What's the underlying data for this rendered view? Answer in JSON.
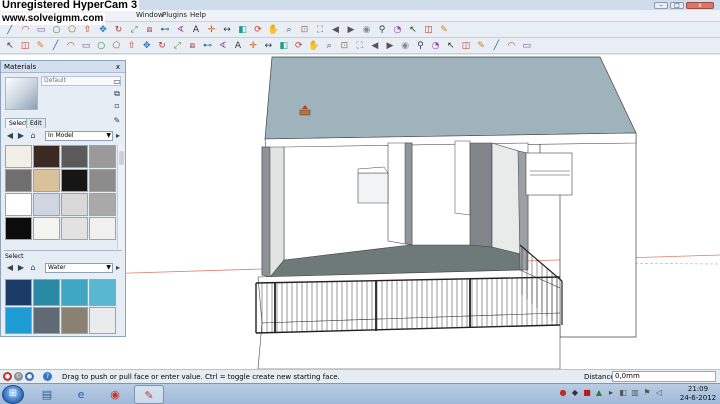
{
  "watermark": {
    "line1": "Unregistered HyperCam 3",
    "line2": "www.solveigmm.com"
  },
  "menu": {
    "items": [
      "Window",
      "Plugins",
      "Help"
    ]
  },
  "materials": {
    "title": "Materials",
    "close": "x",
    "name_placeholder": "Default",
    "tabs": {
      "select": "Select",
      "edit": "Edit"
    },
    "collection1": "In Model",
    "section2_label": "Select",
    "collection2": "Water",
    "swatches_top": [
      "#f2efe6",
      "#3a2a22",
      "#5a5a5a",
      "#9a9a9a",
      "#6f6f6f",
      "#d9c19a",
      "#161616",
      "#8c8c8c",
      "#ffffff",
      "#cfd6e2",
      "#d8d8d8",
      "#a9a9a9",
      "#0c0c0c",
      "#f4f4f0",
      "#e2e2e2",
      "#f0f0f0"
    ],
    "swatches_bottom": [
      "#1b3c66",
      "#2a8aa6",
      "#3fa6c2",
      "#5ab7d0",
      "#1f9bd6",
      "#5f6a74",
      "#8b8173",
      "#e9ecec"
    ]
  },
  "status": {
    "hint": "Drag to push or pull face or enter value.  Ctrl = toggle create new starting face.",
    "distance_label": "Distance",
    "distance_value": "0,0mm"
  },
  "taskbar": {
    "time": "21:09",
    "date": "24-6-2012"
  },
  "icons": {
    "toolbar1": [
      "select-icon",
      "eraser-icon",
      "paint-icon",
      "line-icon",
      "arc-icon",
      "rectangle-icon",
      "circle-icon",
      "polygon-icon",
      "pushpull-icon",
      "move-icon",
      "rotate-icon",
      "scale-icon",
      "offset-icon",
      "tape-icon",
      "protractor-icon",
      "text-icon",
      "axes-icon",
      "dimension-icon",
      "section-icon",
      "orbit-icon",
      "pan-icon",
      "zoom-icon",
      "zoom-window-icon",
      "zoom-extents-icon",
      "previous-icon",
      "next-icon",
      "camera-icon",
      "walk-icon",
      "lookaround-icon"
    ]
  }
}
